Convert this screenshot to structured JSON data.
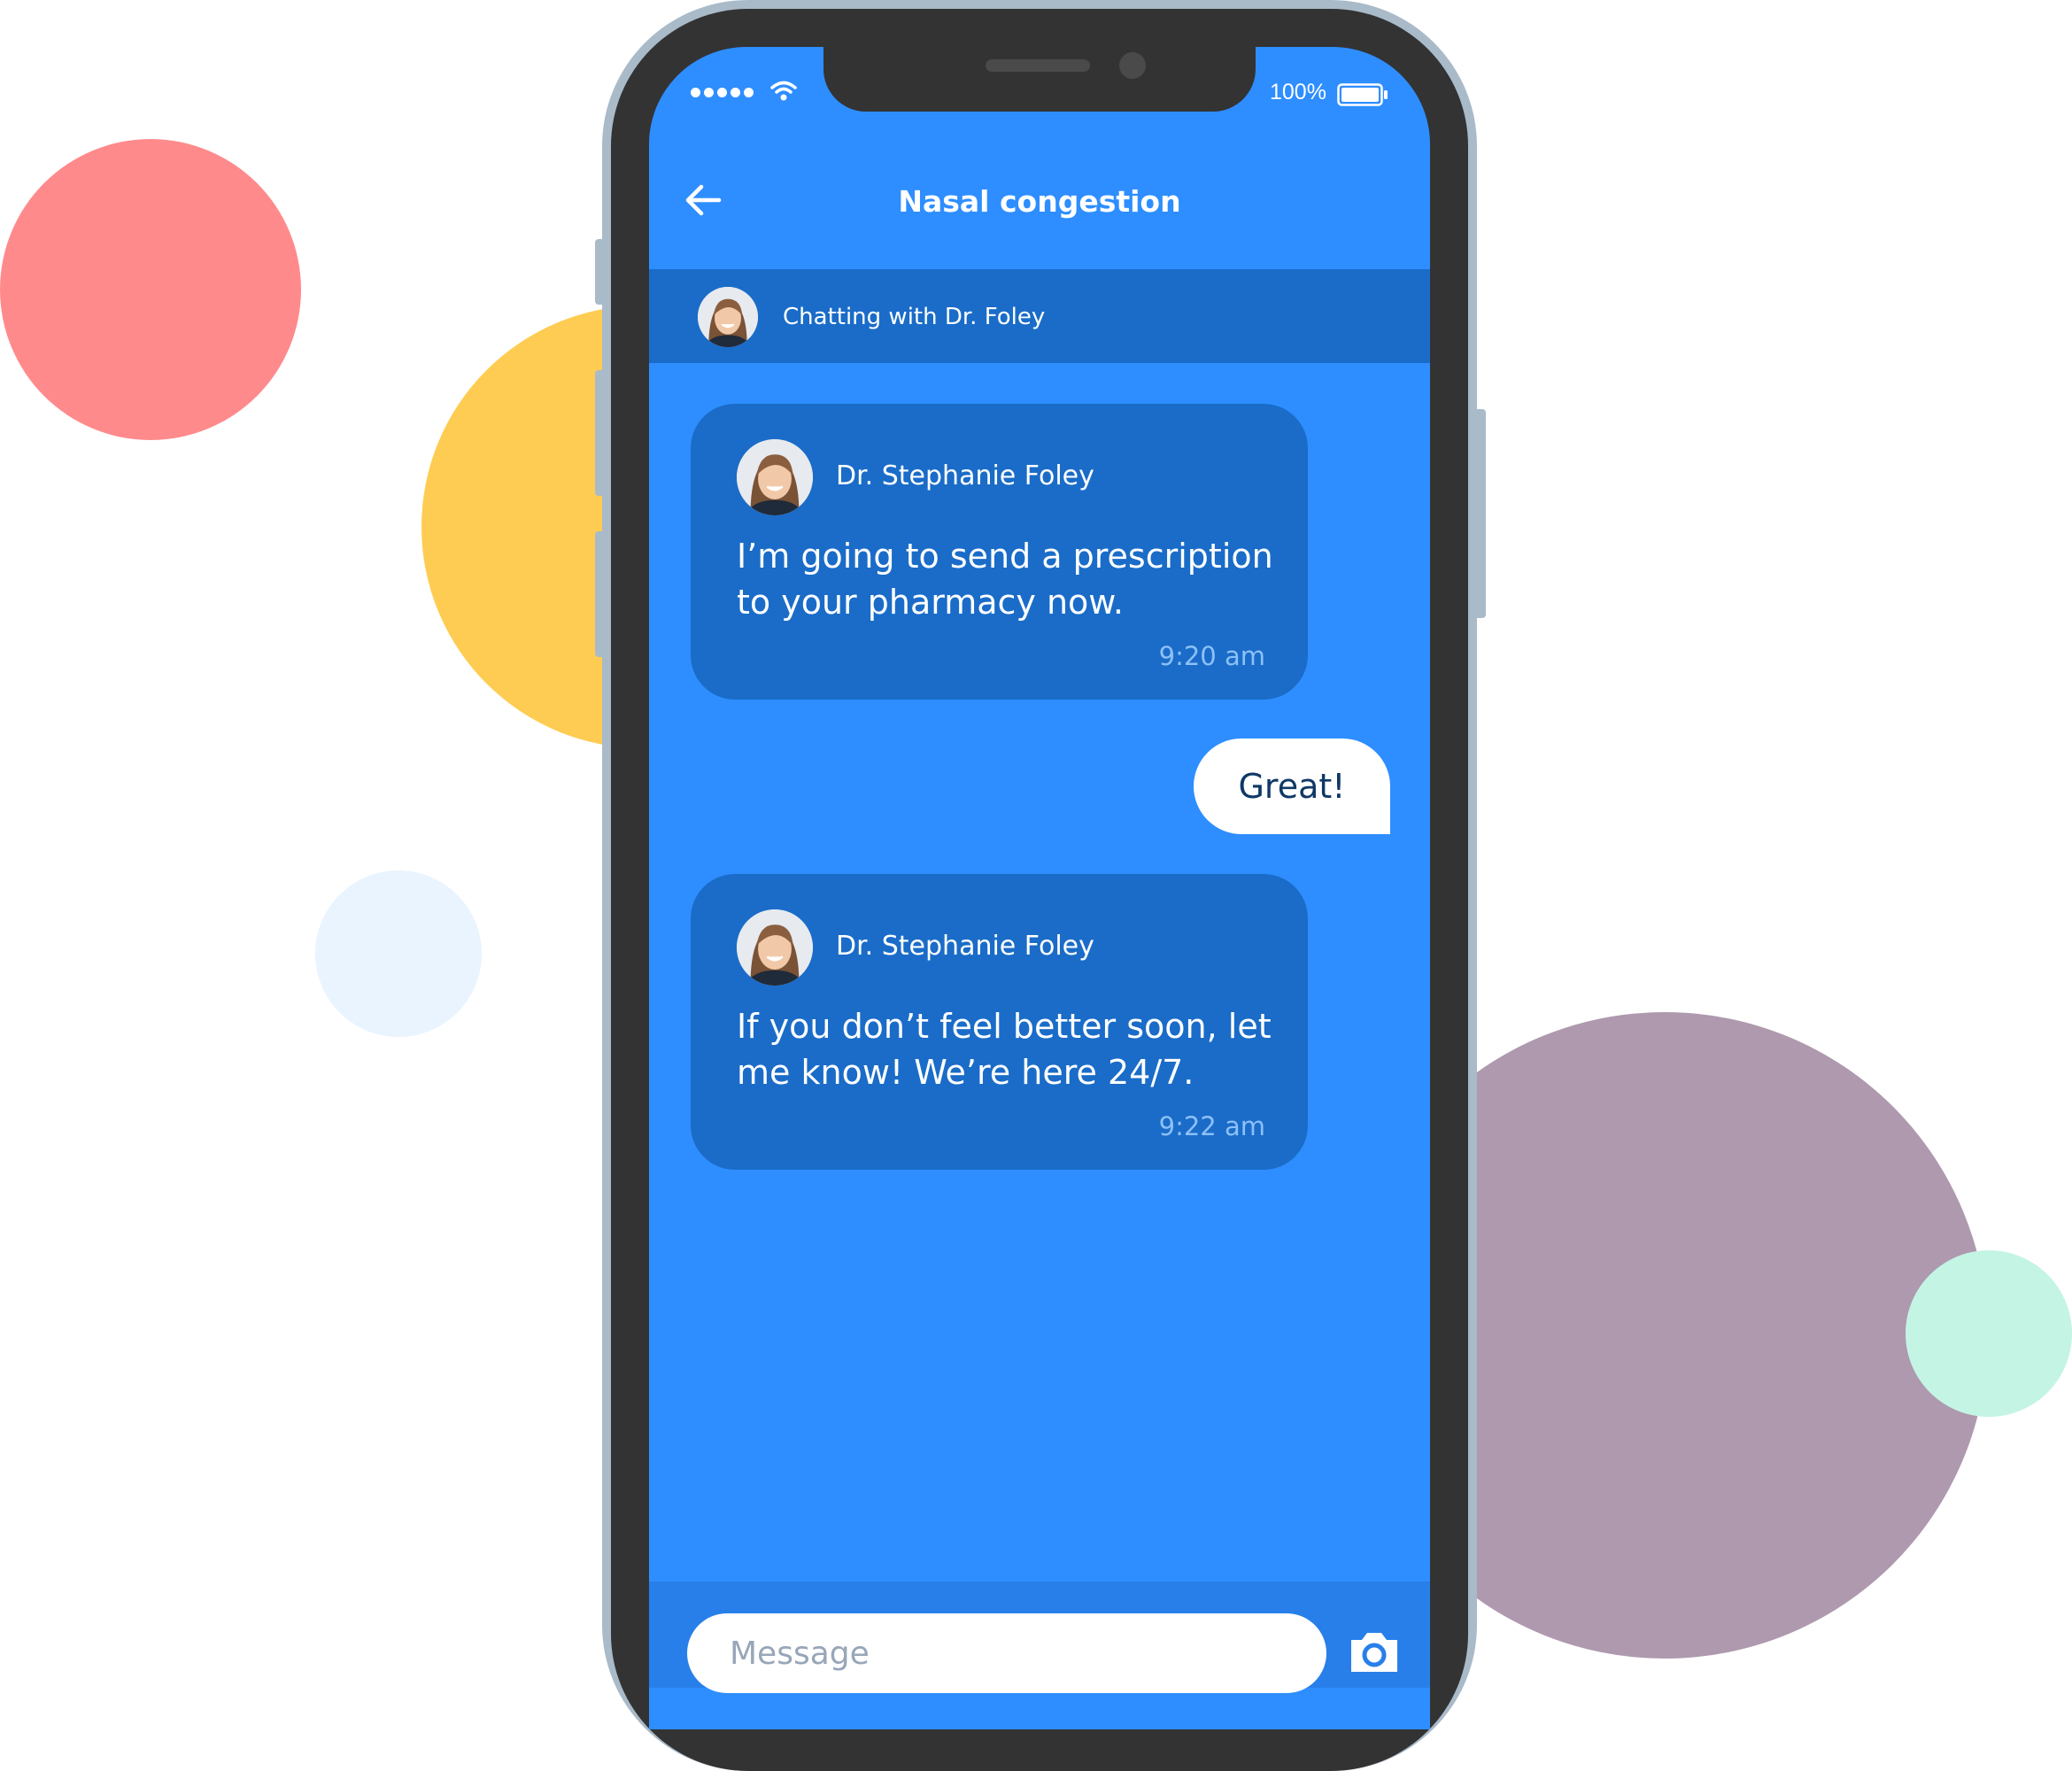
{
  "status_bar": {
    "battery_text": "100%",
    "battery_level": 1.0
  },
  "header": {
    "title": "Nasal congestion",
    "back_icon": "arrow-left-icon"
  },
  "banner": {
    "text": "Chatting with Dr. Foley"
  },
  "messages": [
    {
      "sender": "Dr. Stephanie Foley",
      "text": "I’m going to send a prescription to your pharmacy now.",
      "time": "9:20 am",
      "direction": "incoming"
    },
    {
      "text": "Great!",
      "direction": "outgoing"
    },
    {
      "sender": "Dr. Stephanie Foley",
      "text": "If you don’t feel better soon, let me know! We’re here 24/7.",
      "time": "9:22 am",
      "direction": "incoming"
    }
  ],
  "composer": {
    "placeholder": "Message",
    "camera_icon": "camera-icon"
  },
  "colors": {
    "screen_bg": "#2E8EFF",
    "bubble_incoming": "#1A6CC8",
    "bubble_outgoing": "#FFFFFF",
    "decor_red": "#FF8A8C",
    "decor_yellow": "#FECC52",
    "decor_light_blue": "#E9F4FE",
    "decor_purple": "#AE99AE",
    "decor_mint": "#C4F4E3"
  }
}
